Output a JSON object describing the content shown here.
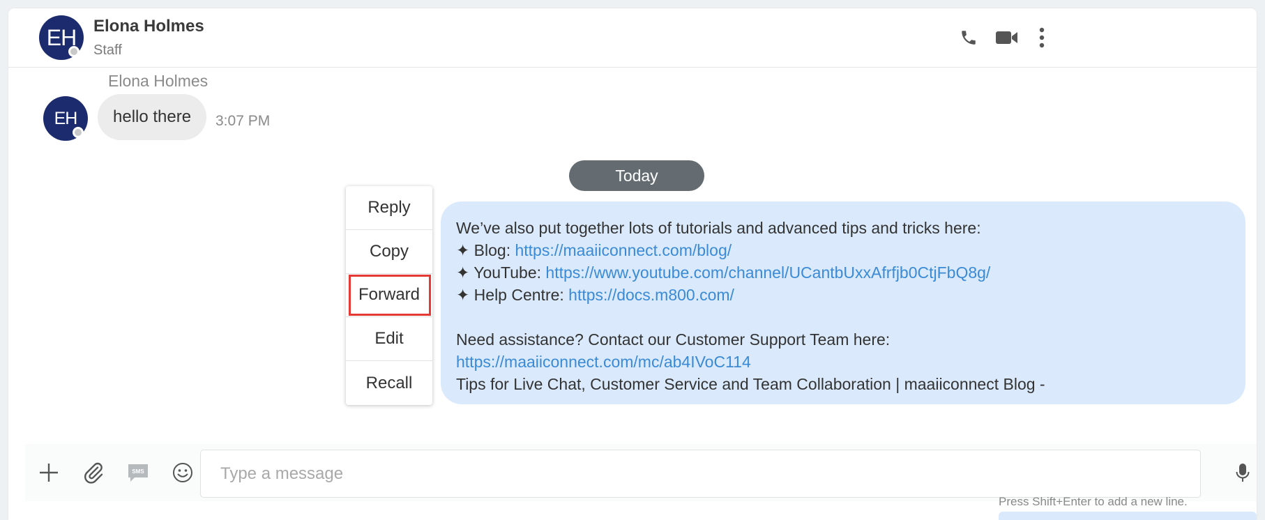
{
  "header": {
    "contact_initials": "EH",
    "contact_name": "Elona Holmes",
    "contact_role": "Staff",
    "icons": [
      "phone-icon",
      "video-camera-icon",
      "more-vertical-icon"
    ]
  },
  "messages": {
    "incoming": {
      "sender_name": "Elona Holmes",
      "initials": "EH",
      "text": "hello there",
      "time": "3:07 PM"
    },
    "day_separator": "Today",
    "outgoing": {
      "line1": "We’ve also put together lots of tutorials and advanced tips and tricks here:",
      "blog_prefix": "✦ Blog: ",
      "blog_url": "https://maaiiconnect.com/blog/",
      "youtube_prefix": "✦ YouTube: ",
      "youtube_url": "https://www.youtube.com/channel/UCantbUxxAfrfjb0CtjFbQ8g/",
      "help_prefix": "✦ Help Centre: ",
      "help_url": "https://docs.m800.com/",
      "support_line": "Need assistance? Contact our Customer Support Team here:",
      "support_url": "https://maaiiconnect.com/mc/ab4IVoC114",
      "tips_line": "Tips for Live Chat, Customer Service and Team Collaboration | maaiiconnect Blog -"
    }
  },
  "context_menu": {
    "items": [
      "Reply",
      "Copy",
      "Forward",
      "Edit",
      "Recall"
    ],
    "highlighted": "Forward"
  },
  "composer": {
    "placeholder": "Type a message",
    "value": "",
    "hint": "Press Shift+Enter to add a new line.",
    "icons": [
      "plus-icon",
      "paperclip-icon",
      "sms-icon",
      "emoji-icon",
      "microphone-icon"
    ],
    "sms_label": "SMS"
  },
  "colors": {
    "avatar": "#1c2b6e",
    "outgoing_bubble": "#daeafc",
    "incoming_bubble": "#ececec",
    "link": "#3a8ad6",
    "day_pill": "#646c71",
    "highlight_border": "#e53935"
  }
}
